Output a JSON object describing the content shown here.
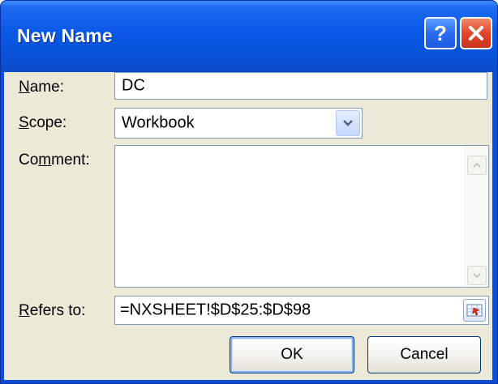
{
  "window": {
    "title": "New Name",
    "help_glyph": "?"
  },
  "form": {
    "name_label_accel": "N",
    "name_label_rest": "ame:",
    "name_value": "DC",
    "scope_label_accel": "S",
    "scope_label_rest": "cope:",
    "scope_value": "Workbook",
    "comment_label_pre": "Co",
    "comment_label_accel": "m",
    "comment_label_rest": "ment:",
    "comment_value": "",
    "refers_label_accel": "R",
    "refers_label_rest": "efers to:",
    "refers_value": "=NXSHEET!$D$25:$D$98"
  },
  "buttons": {
    "ok": "OK",
    "cancel": "Cancel"
  },
  "colors": {
    "titlebar": "#0a58e6",
    "client_bg": "#ece9d8",
    "close_button": "#e0462a"
  },
  "icons": [
    "help-icon",
    "close-icon",
    "chevron-down-icon",
    "scroll-up-icon",
    "scroll-down-icon",
    "range-collapse-icon"
  ]
}
